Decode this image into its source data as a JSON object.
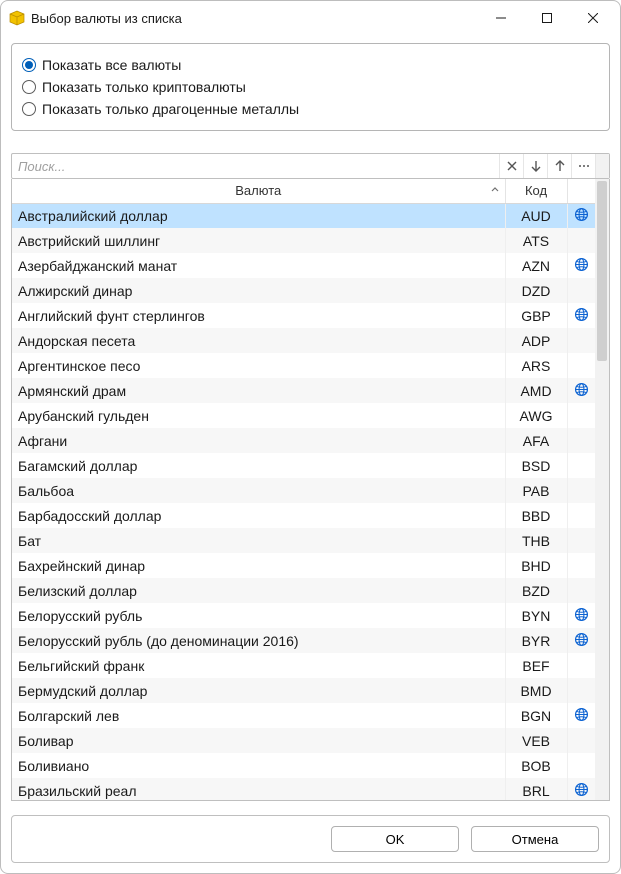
{
  "window": {
    "title": "Выбор валюты из списка"
  },
  "filters": {
    "options": [
      {
        "label": "Показать все валюты",
        "selected": true
      },
      {
        "label": "Показать только криптовалюты",
        "selected": false
      },
      {
        "label": "Показать только драгоценные металлы",
        "selected": false
      }
    ]
  },
  "search": {
    "placeholder": "Поиск...",
    "value": ""
  },
  "columns": {
    "currency": "Валюта",
    "code": "Код"
  },
  "rows": [
    {
      "name": "Австралийский доллар",
      "code": "AUD",
      "globe": true,
      "selected": true
    },
    {
      "name": "Австрийский шиллинг",
      "code": "ATS",
      "globe": false
    },
    {
      "name": "Азербайджанский манат",
      "code": "AZN",
      "globe": true
    },
    {
      "name": "Алжирский динар",
      "code": "DZD",
      "globe": false
    },
    {
      "name": "Английский фунт стерлингов",
      "code": "GBP",
      "globe": true
    },
    {
      "name": "Андорская песета",
      "code": "ADP",
      "globe": false
    },
    {
      "name": "Аргентинское песо",
      "code": "ARS",
      "globe": false
    },
    {
      "name": "Армянский драм",
      "code": "AMD",
      "globe": true
    },
    {
      "name": "Арубанский гульден",
      "code": "AWG",
      "globe": false
    },
    {
      "name": "Афгани",
      "code": "AFA",
      "globe": false
    },
    {
      "name": "Багамский доллар",
      "code": "BSD",
      "globe": false
    },
    {
      "name": "Бальбоа",
      "code": "PAB",
      "globe": false
    },
    {
      "name": "Барбадосский доллар",
      "code": "BBD",
      "globe": false
    },
    {
      "name": "Бат",
      "code": "THB",
      "globe": false
    },
    {
      "name": "Бахрейнский динар",
      "code": "BHD",
      "globe": false
    },
    {
      "name": "Белизский доллар",
      "code": "BZD",
      "globe": false
    },
    {
      "name": "Белорусский рубль",
      "code": "BYN",
      "globe": true
    },
    {
      "name": "Белорусский рубль (до деноминации 2016)",
      "code": "BYR",
      "globe": true
    },
    {
      "name": "Бельгийский франк",
      "code": "BEF",
      "globe": false
    },
    {
      "name": "Бермудский доллар",
      "code": "BMD",
      "globe": false
    },
    {
      "name": "Болгарский лев",
      "code": "BGN",
      "globe": true
    },
    {
      "name": "Боливар",
      "code": "VEB",
      "globe": false
    },
    {
      "name": "Боливиано",
      "code": "BOB",
      "globe": false
    },
    {
      "name": "Бразильский реал",
      "code": "BRL",
      "globe": true
    }
  ],
  "buttons": {
    "ok": "OK",
    "cancel": "Отмена"
  }
}
